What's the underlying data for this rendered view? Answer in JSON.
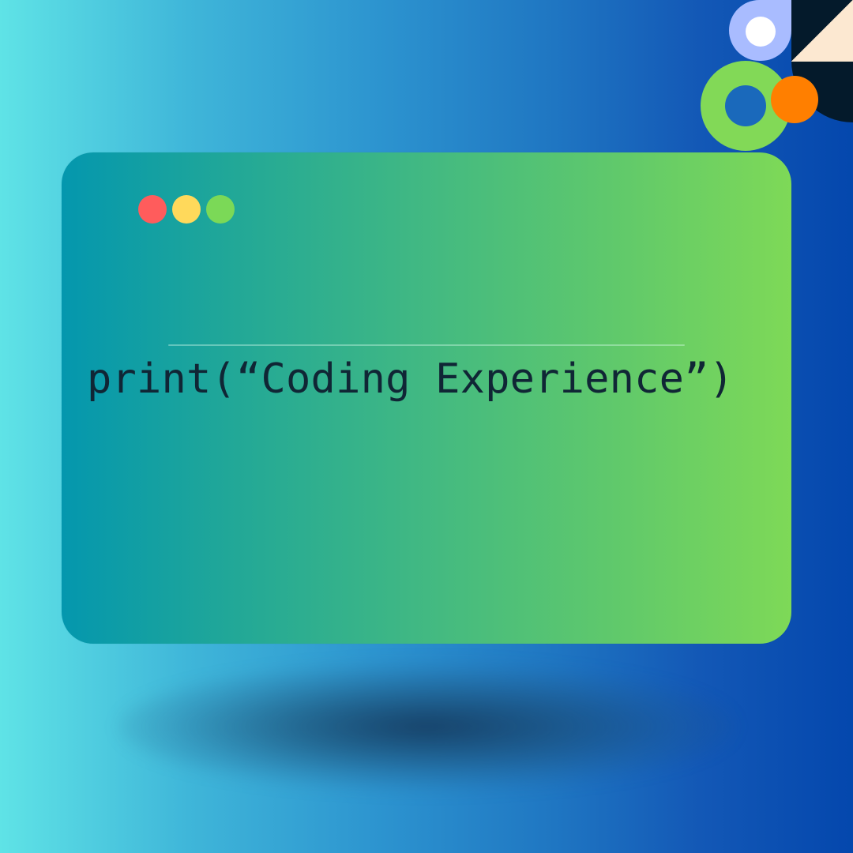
{
  "code": {
    "line": "print(“Coding Experience”)"
  },
  "icons": {
    "window_controls": [
      "close-dot-icon",
      "minimize-dot-icon",
      "maximize-dot-icon"
    ],
    "decorations": [
      "lavender-pill-icon",
      "white-dot-icon",
      "green-ring-icon",
      "orange-dot-icon",
      "corner-quarter-circle-icon"
    ]
  },
  "colors": {
    "window_gradient": [
      "#0497ae",
      "#7ed957"
    ],
    "background_gradient": [
      "#5fe3e6",
      "#0447ad"
    ],
    "close": "#ff5c5c",
    "minimize": "#ffd95b",
    "maximize": "#7bd957",
    "code_text": "#102635",
    "accent_lavender": "#a9bcff",
    "accent_green": "#82d957",
    "accent_orange": "#ff7f00",
    "accent_cream": "#fce8d1",
    "accent_dark": "#041a2b"
  }
}
